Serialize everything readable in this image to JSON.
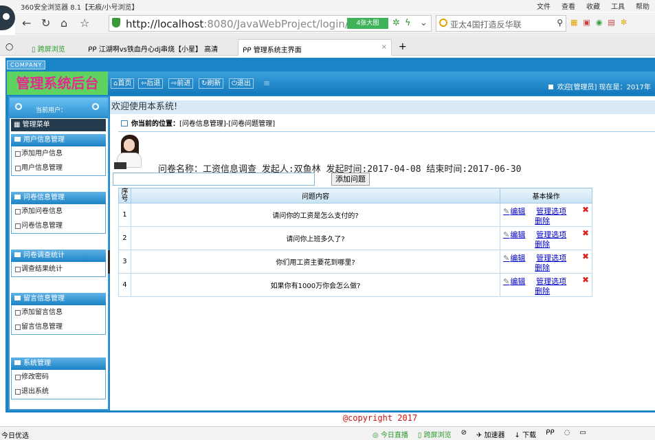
{
  "browser": {
    "title": "360安全浏览器 8.1【无痕/小号浏览】",
    "menu": [
      "文件",
      "查看",
      "收藏",
      "工具",
      "帮助"
    ],
    "url_host": "http://localhost",
    "url_path": ":8080/JavaWebProject/login/login_Cl",
    "big_image_label": "4张大图",
    "search_text": "亚太4国打造反华联",
    "tabs": [
      {
        "label": "跨屏浏览"
      },
      {
        "label": "江湖啊vs铁血丹心dj串烧【小星】 高清"
      },
      {
        "label": "管理系统主界面"
      }
    ]
  },
  "app": {
    "company": "COMPANY",
    "brand": "管理系统后台",
    "topnav": [
      {
        "label": "首页"
      },
      {
        "label": "后退"
      },
      {
        "label": "前进"
      },
      {
        "label": "刷新"
      },
      {
        "label": "退出"
      }
    ],
    "welcome": "欢迎[管理员]  现在是：2017年"
  },
  "sidebar": {
    "current_user_label": "当前用户：",
    "main_menu": "管理菜单",
    "groups": [
      {
        "title": "用户信息管理",
        "items": [
          "添加用户信息",
          "用户信息管理"
        ]
      },
      {
        "title": "问卷信息管理",
        "items": [
          "添加问卷信息",
          "问卷信息管理"
        ]
      },
      {
        "title": "问卷调查统计",
        "items": [
          "调查结果统计"
        ]
      },
      {
        "title": "留言信息管理",
        "items": [
          "添加留言信息",
          "留言信息管理"
        ]
      },
      {
        "title": "系统管理",
        "items": [
          "修改密码",
          "退出系统"
        ]
      }
    ]
  },
  "main": {
    "welcome_text": "欢迎使用本系统!",
    "crumb_label": "你当前的位置：",
    "crumb_path": "[问卷信息管理]-[问卷问题管理]",
    "questionnaire_info": "问卷名称：工资信息调查    发起人:双鱼林   发起时间:2017-04-08   结束时间:2017-06-30",
    "add_button": "添加问题",
    "table": {
      "headers": [
        "序号",
        "问题内容",
        "基本操作"
      ],
      "rows": [
        {
          "no": "1",
          "content": "请问你的工资是怎么支付的?"
        },
        {
          "no": "2",
          "content": "请问你上班多久了?"
        },
        {
          "no": "3",
          "content": "你们用工资主要花到哪里?"
        },
        {
          "no": "4",
          "content": "如果你有1000万你会怎么做?"
        }
      ],
      "edit_label": "编辑",
      "manage_label": "管理选项",
      "delete_label": "删除"
    },
    "copyright": "@copyright 2017"
  },
  "statusbar": {
    "left": "今日优选",
    "items": [
      "今日直播",
      "跨屏浏览",
      "加速器",
      "下载"
    ]
  }
}
